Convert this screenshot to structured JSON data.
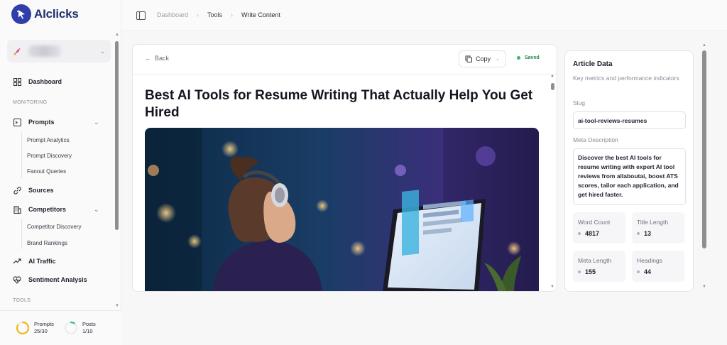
{
  "app": {
    "name": "AIclicks"
  },
  "sidebar": {
    "nav": [
      {
        "label": "Dashboard"
      },
      {
        "label": "Prompts"
      },
      {
        "label": "Sources"
      },
      {
        "label": "Competitors"
      },
      {
        "label": "AI Traffic"
      },
      {
        "label": "Sentiment Analysis"
      }
    ],
    "sections": {
      "monitoring": "MONITORING",
      "tools": "TOOLS"
    },
    "prompts_sub": [
      "Prompt Analytics",
      "Prompt Discovery",
      "Fanout Queries"
    ],
    "competitors_sub": [
      "Competitor Discovery",
      "Brand Rankings"
    ],
    "usage": {
      "prompts_label": "Prompts",
      "prompts_value": "25/30",
      "prompts_fraction": 0.8333,
      "posts_label": "Posts",
      "posts_value": "1/10",
      "posts_fraction": 0.1
    }
  },
  "breadcrumb": [
    "Dashboard",
    "Tools",
    "Write Content"
  ],
  "editor": {
    "back_label": "Back",
    "copy_label": "Copy",
    "saved_label": "Saved",
    "title": "Best AI Tools for Resume Writing That Actually Help You Get Hired"
  },
  "article_data": {
    "title": "Article Data",
    "subtitle": "Key metrics and performance indicators",
    "slug_label": "Slug",
    "slug": "ai-tool-reviews-resumes",
    "meta_label": "Meta Description",
    "meta_description": "Discover the best AI tools for resume writing with expert AI tool reviews from allaboutai, boost ATS scores, tailor each application, and get hired faster.",
    "stats": [
      {
        "label": "Word Count",
        "value": "4817"
      },
      {
        "label": "Title Length",
        "value": "13"
      },
      {
        "label": "Meta Length",
        "value": "155"
      },
      {
        "label": "Headings",
        "value": "44"
      }
    ]
  },
  "colors": {
    "brand": "#2f3ea8",
    "saved": "#2bbf6b",
    "usage_ring": "#f2b619",
    "posts_ring": "#3bbf7a"
  }
}
